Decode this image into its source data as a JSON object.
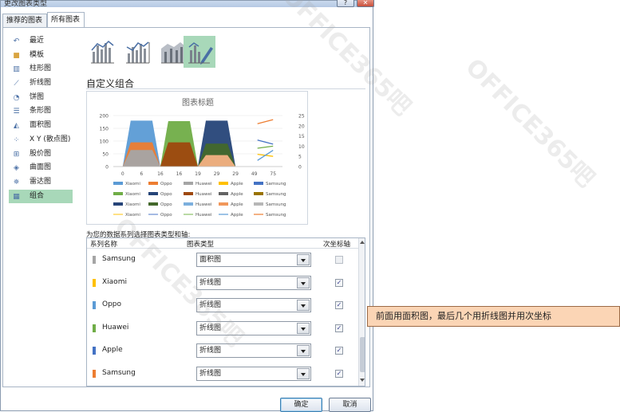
{
  "dialog": {
    "title": "更改图表类型",
    "tabs": [
      {
        "label": "推荐的图表"
      },
      {
        "label": "所有图表"
      }
    ],
    "ok_label": "确定",
    "cancel_label": "取消"
  },
  "sidebar": {
    "items": [
      {
        "label": "最近",
        "icon": "undo-icon"
      },
      {
        "label": "模板",
        "icon": "folder-icon"
      },
      {
        "label": "柱形图",
        "icon": "column-chart-icon"
      },
      {
        "label": "折线图",
        "icon": "line-chart-icon"
      },
      {
        "label": "饼图",
        "icon": "pie-chart-icon"
      },
      {
        "label": "条形图",
        "icon": "bar-chart-icon"
      },
      {
        "label": "面积图",
        "icon": "area-chart-icon"
      },
      {
        "label": "X Y (散点图)",
        "icon": "scatter-chart-icon"
      },
      {
        "label": "股价图",
        "icon": "stock-chart-icon"
      },
      {
        "label": "曲面图",
        "icon": "surface-chart-icon"
      },
      {
        "label": "雷达图",
        "icon": "radar-chart-icon"
      },
      {
        "label": "组合",
        "icon": "combo-chart-icon"
      }
    ],
    "active_index": 11
  },
  "section_title": "自定义组合",
  "chart_data": {
    "type": "area",
    "title": "图表标题",
    "x": [
      "0",
      "6",
      "16",
      "16",
      "19",
      "29",
      "29",
      "49",
      "75"
    ],
    "y_left_ticks": [
      "0",
      "50",
      "100",
      "150",
      "200"
    ],
    "y_right_ticks": [
      "0",
      "5",
      "10",
      "15",
      "20",
      "25"
    ],
    "ylim": [
      0,
      200
    ],
    "y2lim": [
      0,
      25
    ],
    "legend_position": "bottom",
    "legend_rows": [
      [
        "Xiaomi",
        "Oppo",
        "Huawei",
        "Apple",
        "Samsung"
      ],
      [
        "Xiaomi",
        "Oppo",
        "Huawei",
        "Apple",
        "Samsung"
      ],
      [
        "Xiaomi",
        "Oppo",
        "Huawei",
        "Apple",
        "Samsung"
      ],
      [
        "Xiaomi",
        "Oppo",
        "Huawei",
        "Apple",
        "Samsung"
      ]
    ],
    "area_humps": [
      {
        "color": "#5b9bd5",
        "peak": 180,
        "i0": 0
      },
      {
        "color": "#70ad47",
        "peak": 178,
        "i0": 2
      },
      {
        "color": "#264478",
        "peak": 180,
        "i0": 4
      },
      {
        "color": "#ed7d31",
        "peak": 95,
        "i0": 0
      },
      {
        "color": "#a5a5a5",
        "peak": 65,
        "i0": 0
      },
      {
        "color": "#9e480e",
        "peak": 95,
        "i0": 2
      },
      {
        "color": "#43682b",
        "peak": 90,
        "i0": 4
      },
      {
        "color": "#f4b183",
        "peak": 45,
        "i0": 4
      }
    ],
    "lines": [
      {
        "color": "#ed7d31",
        "y": [
          21,
          23
        ]
      },
      {
        "color": "#4472c4",
        "y": [
          13,
          11
        ]
      },
      {
        "color": "#70ad47",
        "y": [
          9,
          10
        ]
      },
      {
        "color": "#ffc000",
        "y": [
          6,
          5
        ]
      },
      {
        "color": "#5b9bd5",
        "y": [
          3,
          8
        ]
      }
    ],
    "legend_colors": [
      [
        "#5b9bd5",
        "#ed7d31",
        "#a5a5a5",
        "#ffc000",
        "#4472c4"
      ],
      [
        "#70ad47",
        "#264478",
        "#9e480e",
        "#636363",
        "#997300"
      ],
      [
        "#264478",
        "#43682b",
        "#7cafdd",
        "#f1975a",
        "#b7b7b7"
      ],
      [
        "#ffcd33",
        "#698ed0",
        "#8cc168",
        "#5b9bd5",
        "#ed7d31"
      ]
    ]
  },
  "table": {
    "label": "为您的数据系列选择图表类型和轴:",
    "headers": {
      "name": "系列名称",
      "type": "图表类型",
      "secondary": "次坐标轴"
    },
    "rows": [
      {
        "name": "Samsung",
        "color": "#a5a5a5",
        "type": "面积图",
        "secondary": false
      },
      {
        "name": "Xiaomi",
        "color": "#ffc000",
        "type": "折线图",
        "secondary": true
      },
      {
        "name": "Oppo",
        "color": "#5b9bd5",
        "type": "折线图",
        "secondary": true
      },
      {
        "name": "Huawei",
        "color": "#70ad47",
        "type": "折线图",
        "secondary": true
      },
      {
        "name": "Apple",
        "color": "#4472c4",
        "type": "折线图",
        "secondary": true
      },
      {
        "name": "Samsung",
        "color": "#ed7d31",
        "type": "折线图",
        "secondary": true
      }
    ]
  },
  "callout": "前面用面积图，最后几个用折线图并用次坐标"
}
